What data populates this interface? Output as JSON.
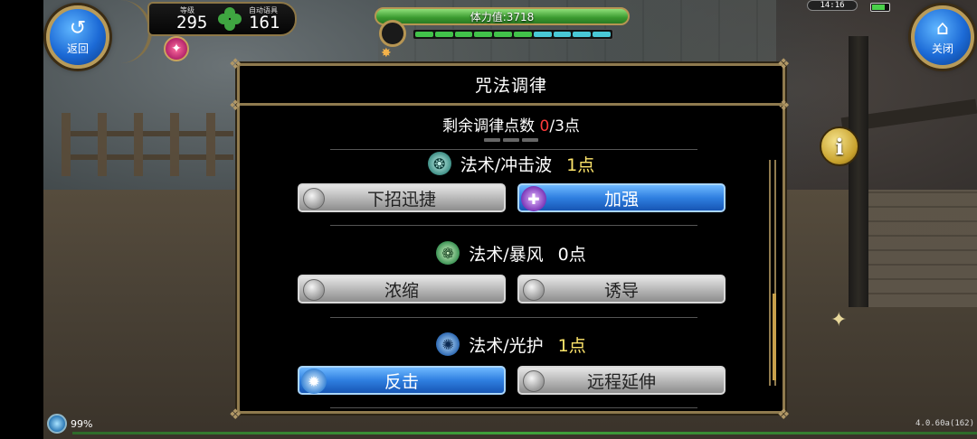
{
  "top_left": {
    "back_label": "返回",
    "level_label": "等级",
    "level_value": "295",
    "fortune_label": "自动语具",
    "fortune_value": "161"
  },
  "stamina": {
    "text": "体力值:3718",
    "segments_filled_green": 6,
    "segments_filled_cyan": 4
  },
  "top_right": {
    "clock": "14:16",
    "close_label": "关闭"
  },
  "dialog": {
    "title": "咒法调律",
    "remaining_prefix": "剩余调律点数 ",
    "remaining_current": "0",
    "remaining_suffix": "/3点",
    "spells": [
      {
        "name": "法术/冲击波",
        "points": "1点",
        "icon": "shockwave-icon",
        "options": [
          {
            "label": "下招迅捷",
            "active": false
          },
          {
            "label": "加强",
            "active": true,
            "emblem": "purple"
          }
        ]
      },
      {
        "name": "法术/暴风",
        "points": "0点",
        "icon": "storm-icon",
        "options": [
          {
            "label": "浓缩",
            "active": false
          },
          {
            "label": "诱导",
            "active": false
          }
        ]
      },
      {
        "name": "法术/光护",
        "points": "1点",
        "icon": "light-shield-icon",
        "options": [
          {
            "label": "反击",
            "active": true,
            "emblem": "blue"
          },
          {
            "label": "远程延伸",
            "active": false
          }
        ]
      }
    ]
  },
  "bottom": {
    "percent": "99%",
    "version": "4.0.60a(162)"
  },
  "colors": {
    "accent_gold": "#8f7a4e",
    "active_blue": "#2f7fe0",
    "points_yellow": "#ffe66b",
    "remaining_red": "#ff3b3b"
  }
}
